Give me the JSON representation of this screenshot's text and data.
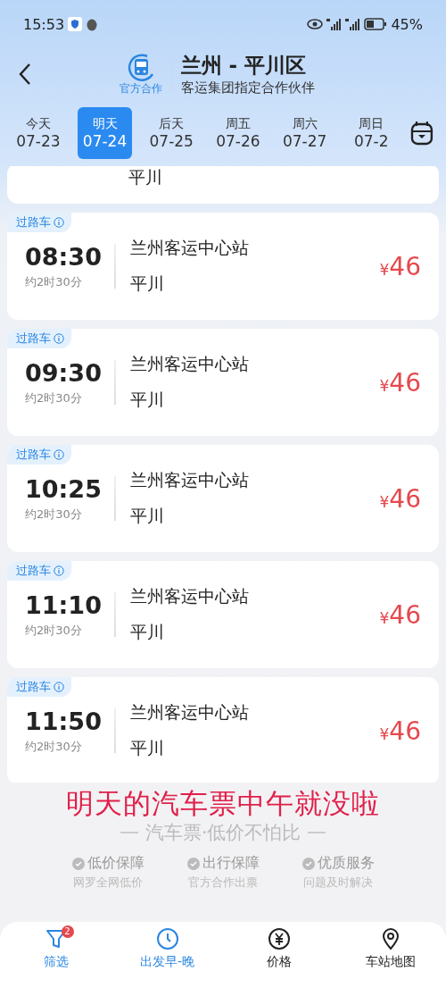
{
  "status_bar": {
    "time": "15:53",
    "battery": "45%"
  },
  "header": {
    "badge": "官方合作",
    "title": "兰州 - 平川区",
    "subtitle": "客运集团指定合作伙伴"
  },
  "dates": [
    {
      "day": "今天",
      "date": "07-23",
      "selected": false
    },
    {
      "day": "明天",
      "date": "07-24",
      "selected": true
    },
    {
      "day": "后天",
      "date": "07-25",
      "selected": false
    },
    {
      "day": "周五",
      "date": "07-26",
      "selected": false
    },
    {
      "day": "周六",
      "date": "07-27",
      "selected": false
    },
    {
      "day": "周日",
      "date": "07-2",
      "selected": false
    }
  ],
  "partial_trip": {
    "to": "平川"
  },
  "trips": [
    {
      "tag": "过路车",
      "time": "08:30",
      "duration": "约2时30分",
      "from": "兰州客运中心站",
      "to": "平川",
      "currency": "¥",
      "price": "46"
    },
    {
      "tag": "过路车",
      "time": "09:30",
      "duration": "约2时30分",
      "from": "兰州客运中心站",
      "to": "平川",
      "currency": "¥",
      "price": "46"
    },
    {
      "tag": "过路车",
      "time": "10:25",
      "duration": "约2时30分",
      "from": "兰州客运中心站",
      "to": "平川",
      "currency": "¥",
      "price": "46"
    },
    {
      "tag": "过路车",
      "time": "11:10",
      "duration": "约2时30分",
      "from": "兰州客运中心站",
      "to": "平川",
      "currency": "¥",
      "price": "46"
    },
    {
      "tag": "过路车",
      "time": "11:50",
      "duration": "约2时30分",
      "from": "兰州客运中心站",
      "to": "平川",
      "currency": "¥",
      "price": "46"
    }
  ],
  "caption": "明天的汽车票中午就没啦",
  "slogan": "汽车票·低价不怕比",
  "guarantees": [
    {
      "title": "低价保障",
      "text": "网罗全网低价"
    },
    {
      "title": "出行保障",
      "text": "官方合作出票"
    },
    {
      "title": "优质服务",
      "text": "问题及时解决"
    }
  ],
  "bottom_nav": [
    {
      "kind": "filter",
      "label": "筛选",
      "badge": "2",
      "active": true
    },
    {
      "kind": "clock",
      "label": "出发早-晚",
      "active": true
    },
    {
      "kind": "price",
      "label": "价格",
      "active": false
    },
    {
      "kind": "pin",
      "label": "车站地图",
      "active": false
    }
  ]
}
